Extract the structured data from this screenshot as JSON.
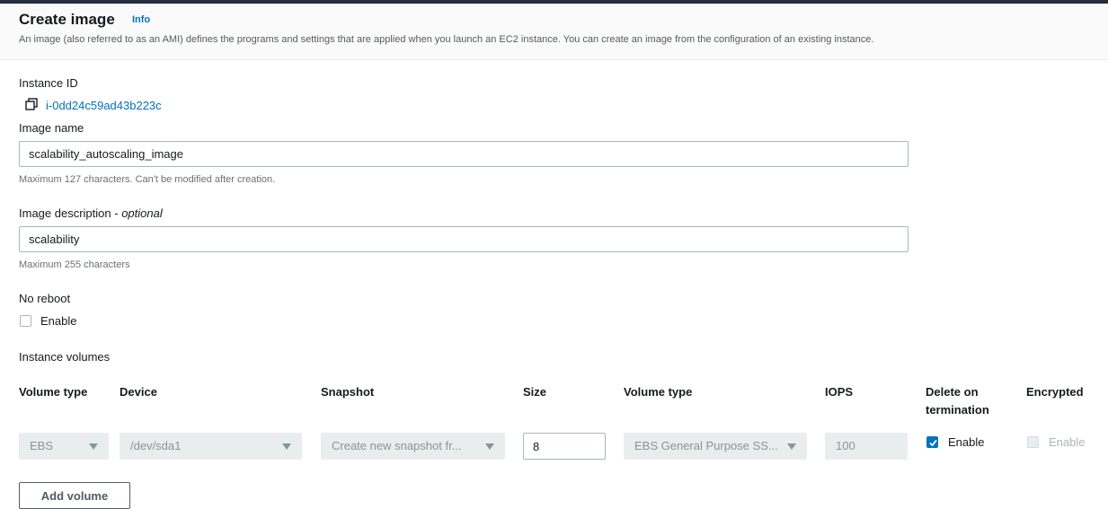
{
  "header": {
    "title": "Create image",
    "info_label": "Info",
    "description": "An image (also referred to as an AMI) defines the programs and settings that are applied when you launch an EC2 instance. You can create an image from the configuration of an existing instance."
  },
  "instance": {
    "label": "Instance ID",
    "id": "i-0dd24c59ad43b223c",
    "icon": "copy-icon"
  },
  "image_name": {
    "label": "Image name",
    "value": "scalability_autoscaling_image",
    "hint": "Maximum 127 characters. Can't be modified after creation."
  },
  "image_description": {
    "label": "Image description",
    "optional": "optional",
    "value": "scalability",
    "hint": "Maximum 255 characters"
  },
  "no_reboot": {
    "label": "No reboot",
    "checkbox_label": "Enable",
    "checked": false
  },
  "volumes": {
    "label": "Instance volumes",
    "headers": {
      "volume_type": "Volume type",
      "device": "Device",
      "snapshot": "Snapshot",
      "size": "Size",
      "volume_type2": "Volume type",
      "iops": "IOPS",
      "delete_on_termination": "Delete on termination",
      "encrypted": "Encrypted"
    },
    "row": {
      "volume_type": "EBS",
      "device": "/dev/sda1",
      "snapshot": "Create new snapshot fr...",
      "size": "8",
      "ebs_type": "EBS General Purpose SS...",
      "iops": "100",
      "delete_on_termination_label": "Enable",
      "delete_on_termination_checked": true,
      "encrypted_label": "Enable",
      "encrypted_checked": false
    }
  },
  "add_volume_label": "Add volume",
  "colors": {
    "link": "#0073bb",
    "header_bar": "#232f3e",
    "disabled_bg": "#eaeded"
  }
}
